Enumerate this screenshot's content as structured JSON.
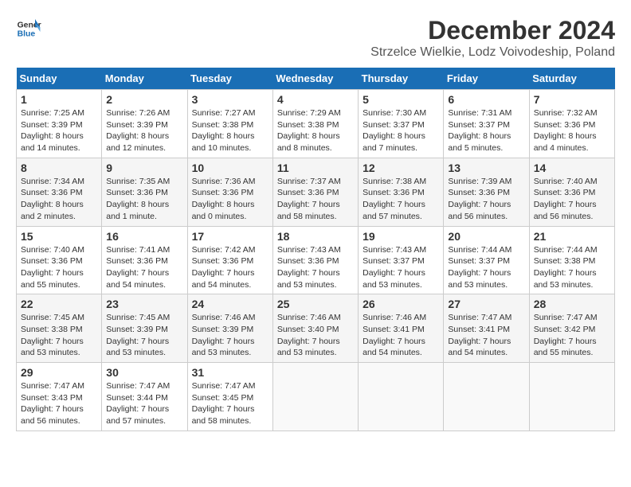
{
  "header": {
    "logo_line1": "General",
    "logo_line2": "Blue",
    "title": "December 2024",
    "subtitle": "Strzelce Wielkie, Lodz Voivodeship, Poland"
  },
  "calendar": {
    "days_of_week": [
      "Sunday",
      "Monday",
      "Tuesday",
      "Wednesday",
      "Thursday",
      "Friday",
      "Saturday"
    ],
    "weeks": [
      [
        {
          "day": "",
          "info": ""
        },
        {
          "day": "2",
          "info": "Sunrise: 7:26 AM\nSunset: 3:39 PM\nDaylight: 8 hours\nand 12 minutes."
        },
        {
          "day": "3",
          "info": "Sunrise: 7:27 AM\nSunset: 3:38 PM\nDaylight: 8 hours\nand 10 minutes."
        },
        {
          "day": "4",
          "info": "Sunrise: 7:29 AM\nSunset: 3:38 PM\nDaylight: 8 hours\nand 8 minutes."
        },
        {
          "day": "5",
          "info": "Sunrise: 7:30 AM\nSunset: 3:37 PM\nDaylight: 8 hours\nand 7 minutes."
        },
        {
          "day": "6",
          "info": "Sunrise: 7:31 AM\nSunset: 3:37 PM\nDaylight: 8 hours\nand 5 minutes."
        },
        {
          "day": "7",
          "info": "Sunrise: 7:32 AM\nSunset: 3:36 PM\nDaylight: 8 hours\nand 4 minutes."
        }
      ],
      [
        {
          "day": "8",
          "info": "Sunrise: 7:34 AM\nSunset: 3:36 PM\nDaylight: 8 hours\nand 2 minutes."
        },
        {
          "day": "9",
          "info": "Sunrise: 7:35 AM\nSunset: 3:36 PM\nDaylight: 8 hours\nand 1 minute."
        },
        {
          "day": "10",
          "info": "Sunrise: 7:36 AM\nSunset: 3:36 PM\nDaylight: 8 hours\nand 0 minutes."
        },
        {
          "day": "11",
          "info": "Sunrise: 7:37 AM\nSunset: 3:36 PM\nDaylight: 7 hours\nand 58 minutes."
        },
        {
          "day": "12",
          "info": "Sunrise: 7:38 AM\nSunset: 3:36 PM\nDaylight: 7 hours\nand 57 minutes."
        },
        {
          "day": "13",
          "info": "Sunrise: 7:39 AM\nSunset: 3:36 PM\nDaylight: 7 hours\nand 56 minutes."
        },
        {
          "day": "14",
          "info": "Sunrise: 7:40 AM\nSunset: 3:36 PM\nDaylight: 7 hours\nand 56 minutes."
        }
      ],
      [
        {
          "day": "15",
          "info": "Sunrise: 7:40 AM\nSunset: 3:36 PM\nDaylight: 7 hours\nand 55 minutes."
        },
        {
          "day": "16",
          "info": "Sunrise: 7:41 AM\nSunset: 3:36 PM\nDaylight: 7 hours\nand 54 minutes."
        },
        {
          "day": "17",
          "info": "Sunrise: 7:42 AM\nSunset: 3:36 PM\nDaylight: 7 hours\nand 54 minutes."
        },
        {
          "day": "18",
          "info": "Sunrise: 7:43 AM\nSunset: 3:36 PM\nDaylight: 7 hours\nand 53 minutes."
        },
        {
          "day": "19",
          "info": "Sunrise: 7:43 AM\nSunset: 3:37 PM\nDaylight: 7 hours\nand 53 minutes."
        },
        {
          "day": "20",
          "info": "Sunrise: 7:44 AM\nSunset: 3:37 PM\nDaylight: 7 hours\nand 53 minutes."
        },
        {
          "day": "21",
          "info": "Sunrise: 7:44 AM\nSunset: 3:38 PM\nDaylight: 7 hours\nand 53 minutes."
        }
      ],
      [
        {
          "day": "22",
          "info": "Sunrise: 7:45 AM\nSunset: 3:38 PM\nDaylight: 7 hours\nand 53 minutes."
        },
        {
          "day": "23",
          "info": "Sunrise: 7:45 AM\nSunset: 3:39 PM\nDaylight: 7 hours\nand 53 minutes."
        },
        {
          "day": "24",
          "info": "Sunrise: 7:46 AM\nSunset: 3:39 PM\nDaylight: 7 hours\nand 53 minutes."
        },
        {
          "day": "25",
          "info": "Sunrise: 7:46 AM\nSunset: 3:40 PM\nDaylight: 7 hours\nand 53 minutes."
        },
        {
          "day": "26",
          "info": "Sunrise: 7:46 AM\nSunset: 3:41 PM\nDaylight: 7 hours\nand 54 minutes."
        },
        {
          "day": "27",
          "info": "Sunrise: 7:47 AM\nSunset: 3:41 PM\nDaylight: 7 hours\nand 54 minutes."
        },
        {
          "day": "28",
          "info": "Sunrise: 7:47 AM\nSunset: 3:42 PM\nDaylight: 7 hours\nand 55 minutes."
        }
      ],
      [
        {
          "day": "29",
          "info": "Sunrise: 7:47 AM\nSunset: 3:43 PM\nDaylight: 7 hours\nand 56 minutes."
        },
        {
          "day": "30",
          "info": "Sunrise: 7:47 AM\nSunset: 3:44 PM\nDaylight: 7 hours\nand 57 minutes."
        },
        {
          "day": "31",
          "info": "Sunrise: 7:47 AM\nSunset: 3:45 PM\nDaylight: 7 hours\nand 58 minutes."
        },
        {
          "day": "",
          "info": ""
        },
        {
          "day": "",
          "info": ""
        },
        {
          "day": "",
          "info": ""
        },
        {
          "day": "",
          "info": ""
        }
      ]
    ],
    "week1_day1": {
      "day": "1",
      "info": "Sunrise: 7:25 AM\nSunset: 3:39 PM\nDaylight: 8 hours\nand 14 minutes."
    }
  }
}
